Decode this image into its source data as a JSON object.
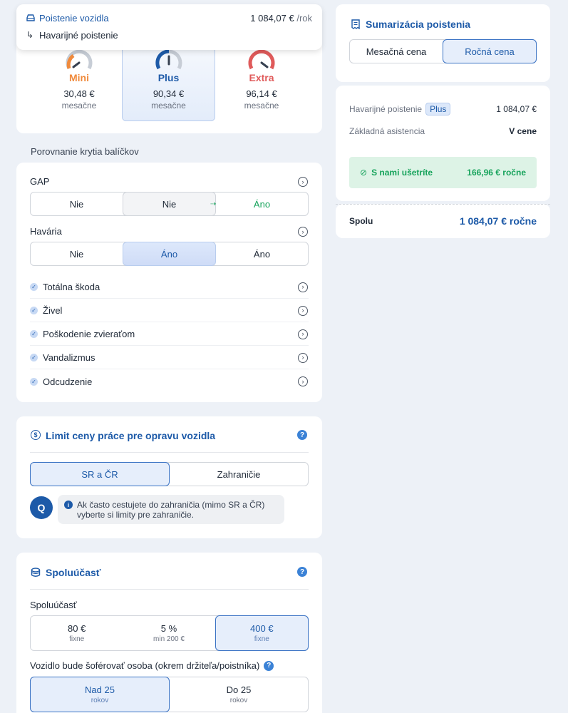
{
  "header": {
    "title": "Poistenie vozidla",
    "price": "1 084,07 €",
    "period": "/rok",
    "sub": "Havarijné poistenie"
  },
  "packages": [
    {
      "name": "Mini",
      "price": "30,48 €",
      "period": "mesačne",
      "color": "#f08a3c"
    },
    {
      "name": "Plus",
      "price": "90,34 €",
      "period": "mesačne",
      "color": "#1d5aa8"
    },
    {
      "name": "Extra",
      "price": "96,14 €",
      "period": "mesačne",
      "color": "#e05a5a"
    }
  ],
  "compare_title": "Porovnanie krytia balíčkov",
  "gap": {
    "label": "GAP",
    "options": [
      "Nie",
      "Nie",
      "Áno"
    ]
  },
  "havaria": {
    "label": "Havária",
    "options": [
      "Nie",
      "Áno",
      "Áno"
    ]
  },
  "coverages": [
    "Totálna škoda",
    "Živel",
    "Poškodenie zvieraťom",
    "Vandalizmus",
    "Odcudzenie"
  ],
  "limit": {
    "title": "Limit ceny práce pre opravu vozidla",
    "options": [
      "SR a ČR",
      "Zahraničie"
    ],
    "info": "Ak často cestujete do zahraničia (mimo SR a ČR) vyberte si limity pre zahraničie."
  },
  "spoluucast": {
    "title": "Spoluúčasť",
    "label": "Spoluúčasť",
    "options": [
      {
        "value": "80 €",
        "sub": "fixne"
      },
      {
        "value": "5 %",
        "sub": "min 200 €"
      },
      {
        "value": "400 €",
        "sub": "fixne"
      }
    ],
    "driver_label": "Vozidlo bude šoférovať osoba (okrem držiteľa/poistníka)",
    "driver_options": [
      {
        "value": "Nad 25",
        "sub": "rokov"
      },
      {
        "value": "Do 25",
        "sub": "rokov"
      }
    ]
  },
  "summary": {
    "title": "Sumarizácia poistenia",
    "toggle": [
      "Mesačná cena",
      "Ročná cena"
    ],
    "line1_label": "Havarijné poistenie",
    "line1_badge": "Plus",
    "line1_value": "1 084,07 €",
    "line2_label": "Základná asistencia",
    "line2_value": "V cene",
    "saving_label": "S nami ušetríte",
    "saving_value": "166,96 € ročne",
    "total_label": "Spolu",
    "total_value": "1 084,07 € ročne"
  },
  "colors": {
    "accent": "#1d5aa8",
    "green": "#16a35b",
    "selected_bg": "#e6eefb"
  }
}
